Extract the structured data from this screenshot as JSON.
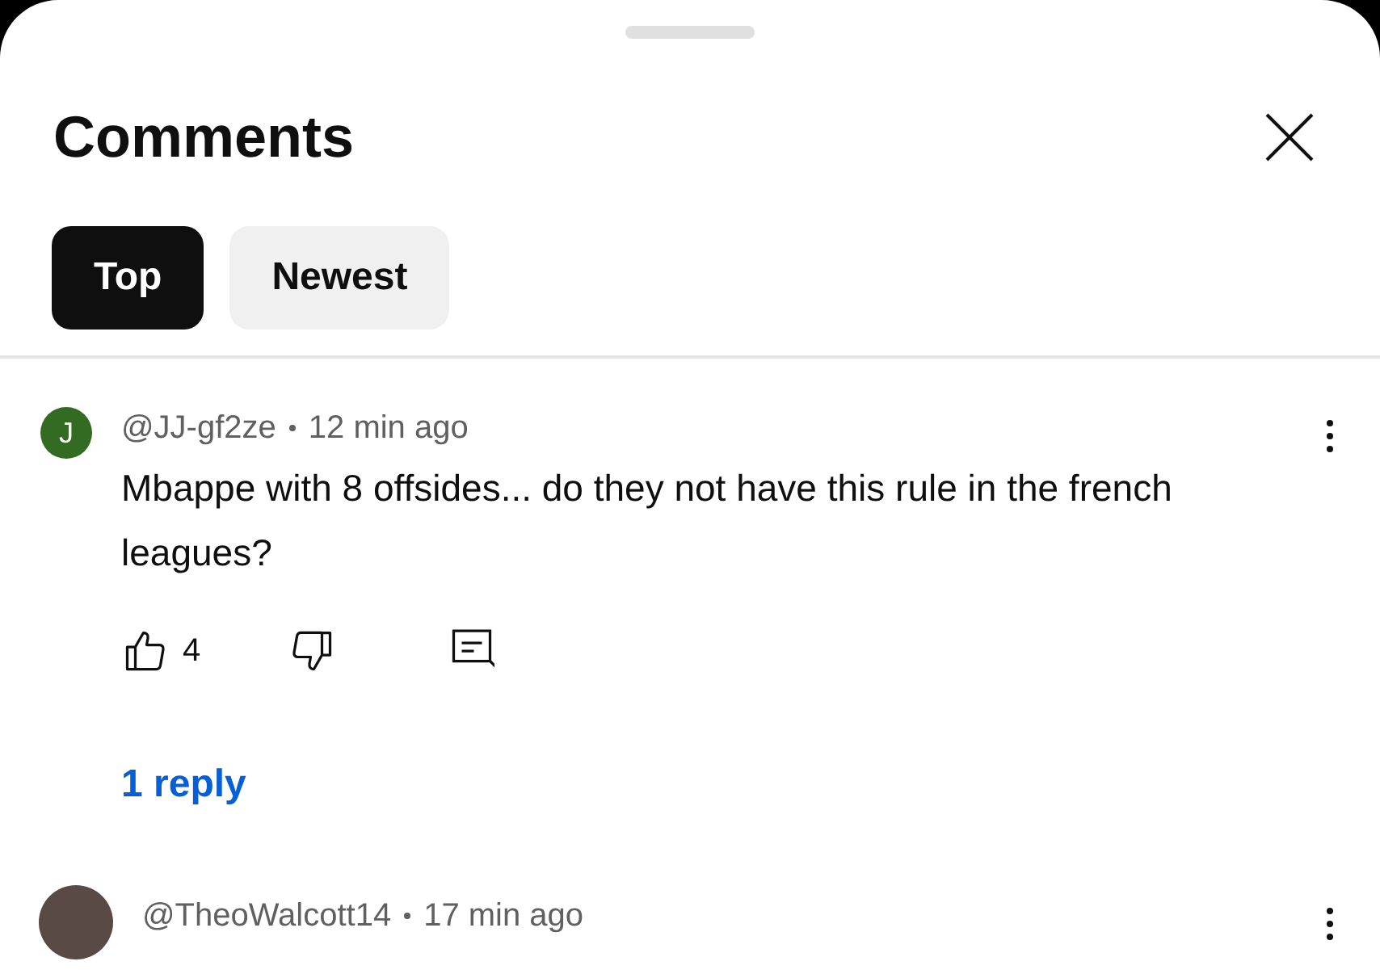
{
  "sheet": {
    "title": "Comments"
  },
  "tabs": [
    {
      "label": "Top",
      "selected": true
    },
    {
      "label": "Newest",
      "selected": false
    }
  ],
  "comments": [
    {
      "author": "@JJ-gf2ze",
      "time": "12 min ago",
      "avatar": {
        "kind": "letter",
        "letter": "J",
        "color": "#346b22"
      },
      "text": "Mbappe with 8 offsides... do they not have this rule in the french leagues?",
      "likes": "4",
      "replies": "1 reply"
    },
    {
      "author": "@TheoWalcott14",
      "time": "17 min ago",
      "avatar": {
        "kind": "photo"
      }
    }
  ]
}
